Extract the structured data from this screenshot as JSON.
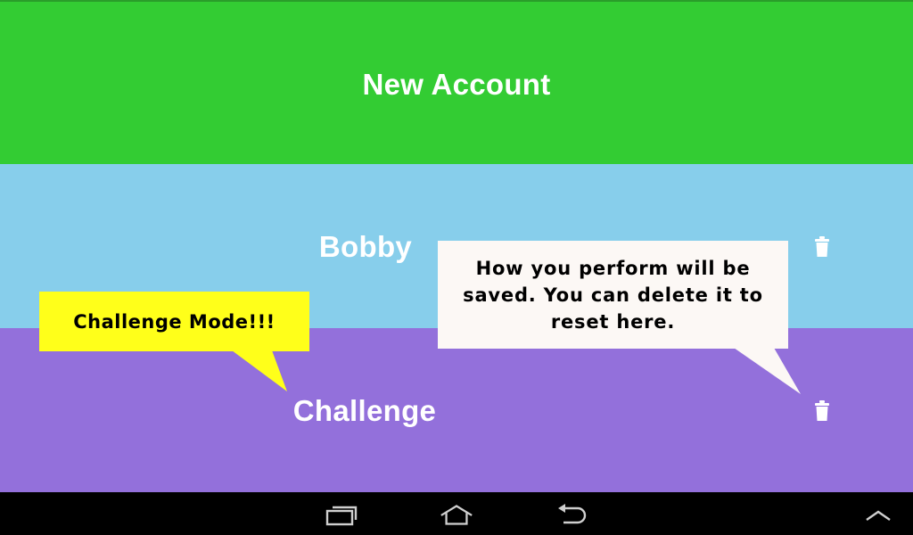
{
  "accounts": {
    "new_account": {
      "label": "New Account",
      "color": "#33cc33"
    },
    "bobby": {
      "label": "Bobby",
      "color": "#87ceeb"
    },
    "challenge": {
      "label": "Challenge",
      "color": "#9370db"
    }
  },
  "tooltips": {
    "challenge_mode": {
      "text": "Challenge Mode!!!",
      "color": "#ffff1a"
    },
    "delete_hint": {
      "text": "How you perform will be saved. You can delete it to reset here.",
      "color": "#fcf8f5"
    }
  },
  "icons": {
    "delete": "trash-icon",
    "recent_apps": "recent-apps-icon",
    "home": "home-icon",
    "back": "back-icon",
    "menu_up": "chevron-up-icon"
  }
}
